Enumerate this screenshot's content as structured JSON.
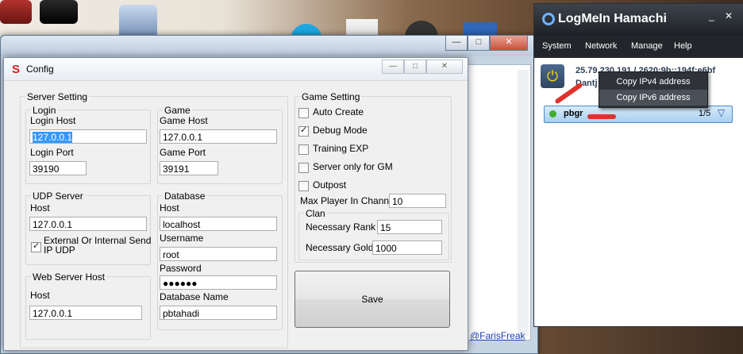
{
  "back_window": {
    "credit_link": "@FarisFreak"
  },
  "config": {
    "title": "Config",
    "server_setting": {
      "legend": "Server Setting",
      "login": {
        "legend": "Login",
        "host_label": "Login Host",
        "host_value": "127.0.0.1",
        "port_label": "Login Port",
        "port_value": "39190"
      },
      "game": {
        "legend": "Game",
        "host_label": "Game Host",
        "host_value": "127.0.0.1",
        "port_label": "Game Port",
        "port_value": "39191"
      },
      "udp": {
        "legend": "UDP Server",
        "host_label": "Host",
        "host_value": "127.0.0.1",
        "checkbox_label": "External Or Internal Send IP UDP",
        "checked": true
      },
      "database": {
        "legend": "Database",
        "host_label": "Host",
        "host_value": "localhost",
        "username_label": "Username",
        "username_value": "root",
        "password_label": "Password",
        "password_value": "●●●●●●",
        "dbname_label": "Database Name",
        "dbname_value": "pbtahadi"
      },
      "web": {
        "legend": "Web Server Host",
        "host_label": "Host",
        "host_value": "127.0.0.1"
      }
    },
    "game_setting": {
      "legend": "Game Setting",
      "checkboxes": [
        {
          "label": "Auto Create",
          "checked": false
        },
        {
          "label": "Debug Mode",
          "checked": true
        },
        {
          "label": "Training EXP",
          "checked": false
        },
        {
          "label": "Server only for GM",
          "checked": false
        },
        {
          "label": "Outpost",
          "checked": false
        }
      ],
      "max_player_label": "Max Player In Channel",
      "max_player_value": "10",
      "clan": {
        "legend": "Clan",
        "rank_label": "Necessary Rank",
        "rank_value": "15",
        "gold_label": "Necessary Gold",
        "gold_value": "1000"
      }
    },
    "save_label": "Save"
  },
  "hamachi": {
    "title": "LogMeIn Hamachi",
    "menu": [
      "System",
      "Network",
      "Manage",
      "Help"
    ],
    "address": "25.79.230.191 / 2620:9b::194f:e6bf",
    "nickname": "Dantj",
    "network_name": "pbgr",
    "network_count": "1/5",
    "context_menu": [
      "Copy IPv4 address",
      "Copy IPv6 address"
    ]
  },
  "colors": {
    "accent": "#3399ff",
    "hamachi_dark": "#22262b",
    "save_bg": "#dcdcdc"
  }
}
